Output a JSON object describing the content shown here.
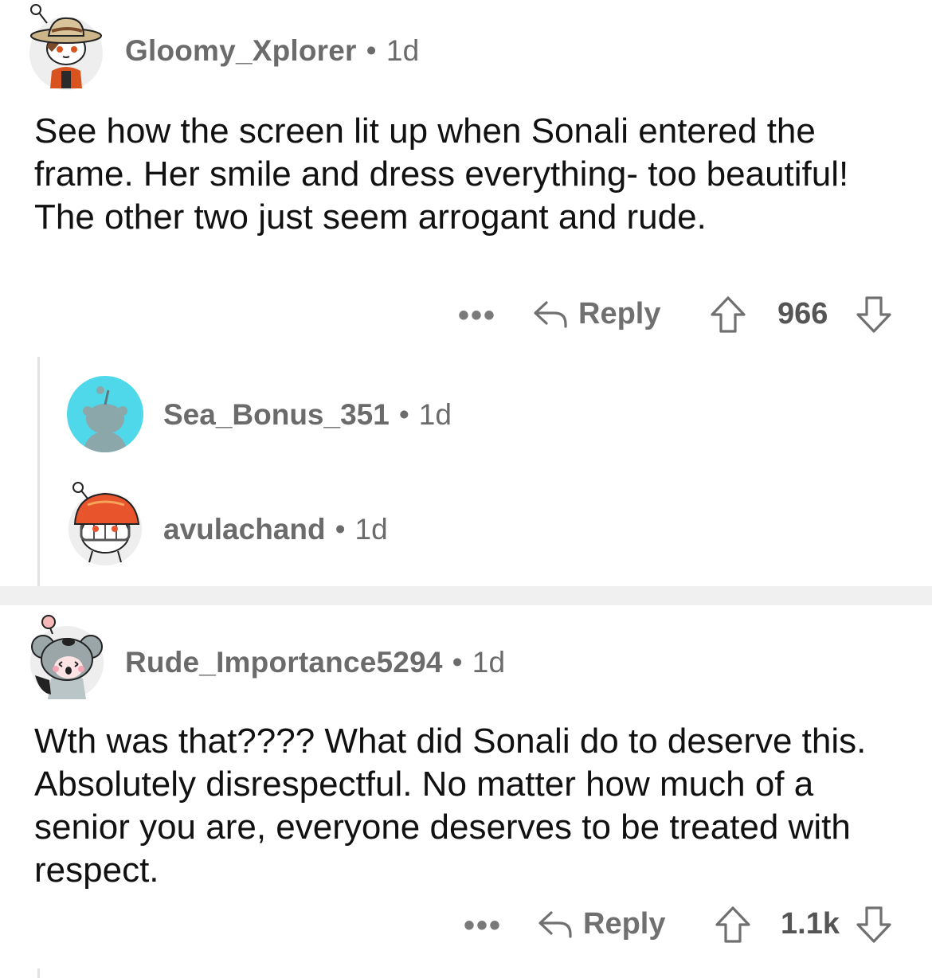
{
  "comments": [
    {
      "username": "Gloomy_Xplorer",
      "age": "1d",
      "text": "See how the screen lit up when Sonali entered the frame. Her smile and dress everything- too beautiful! The other two just seem arrogant and rude.",
      "more": "•••",
      "reply_label": "Reply",
      "votes": "966",
      "replies": [
        {
          "username": "Sea_Bonus_351",
          "age": "1d"
        },
        {
          "username": "avulachand",
          "age": "1d"
        }
      ]
    },
    {
      "username": "Rude_Importance5294",
      "age": "1d",
      "text": "Wth was that???? What did Sonali do to deserve this. Absolutely disrespectful. No matter how much of a senior you are, everyone deserves to be treated with respect.",
      "more": "•••",
      "reply_label": "Reply",
      "votes": "1.1k"
    }
  ],
  "separator_dot": "•",
  "colors": {
    "text": "#111111",
    "meta": "#6b6b6b",
    "separator": "#f0f0f0",
    "thread_line": "#e2e2e2",
    "avatar_cyan": "#4fd7ea",
    "helmet_orange": "#e8542b"
  },
  "icons": [
    "reply-icon",
    "upvote-icon",
    "downvote-icon",
    "more-options-icon"
  ]
}
